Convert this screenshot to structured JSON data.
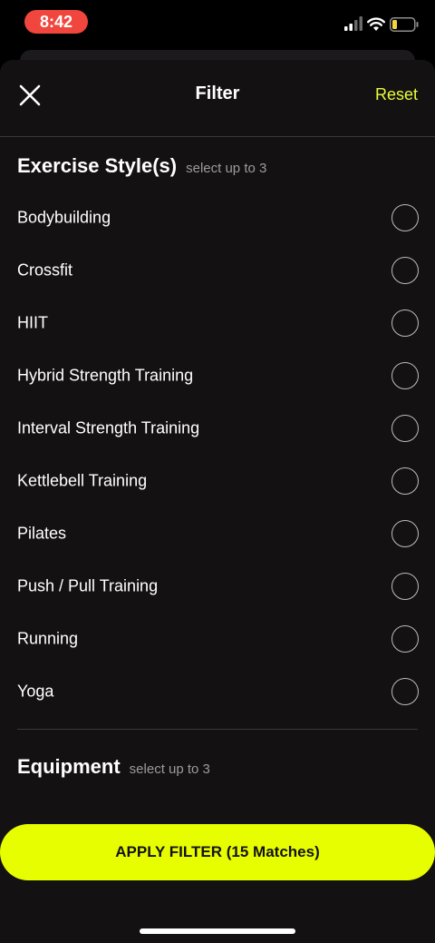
{
  "status_bar": {
    "time": "8:42"
  },
  "nav": {
    "title": "Filter",
    "reset_label": "Reset"
  },
  "exercise_style": {
    "title": "Exercise Style(s)",
    "hint": "select up to 3",
    "items": [
      {
        "label": "Bodybuilding",
        "selected": false
      },
      {
        "label": "Crossfit",
        "selected": false
      },
      {
        "label": "HIIT",
        "selected": false
      },
      {
        "label": "Hybrid Strength Training",
        "selected": false
      },
      {
        "label": "Interval Strength Training",
        "selected": false
      },
      {
        "label": "Kettlebell Training",
        "selected": false
      },
      {
        "label": "Pilates",
        "selected": false
      },
      {
        "label": "Push / Pull Training",
        "selected": false
      },
      {
        "label": "Running",
        "selected": false
      },
      {
        "label": "Yoga",
        "selected": false
      }
    ]
  },
  "equipment": {
    "title": "Equipment",
    "hint": "select up to 3"
  },
  "apply_button": {
    "label": "APPLY FILTER (15 Matches)"
  },
  "colors": {
    "accent": "#e7fe00",
    "reset": "#e6fd3a",
    "background": "#141113",
    "time_pill": "#f0463e"
  }
}
